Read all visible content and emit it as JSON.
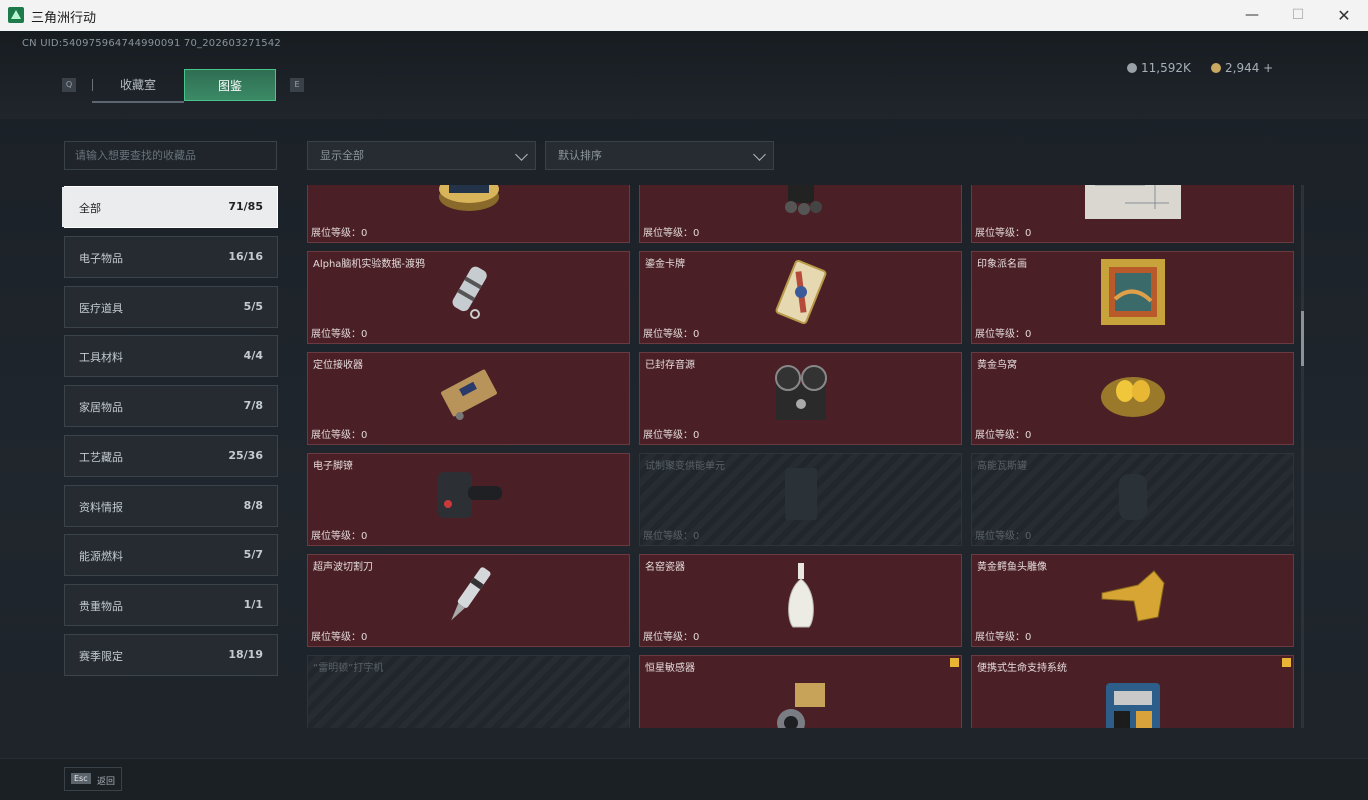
{
  "window": {
    "title": "三角洲行动",
    "minimize": "—",
    "maximize": "☐",
    "close": "✕"
  },
  "header": {
    "uid": "CN UID:540975964744990091 70_202603271542",
    "tab_key_left": "Q",
    "tab_key_right": "E",
    "tabs": [
      {
        "label": "收藏室"
      },
      {
        "label": "图鉴",
        "active": true
      }
    ],
    "currency": [
      {
        "value": "11,592K"
      },
      {
        "value": "2,944 +"
      }
    ]
  },
  "search": {
    "placeholder": "请输入想要查找的收藏品"
  },
  "filters": {
    "show": "显示全部",
    "sort": "默认排序"
  },
  "categories": [
    {
      "label": "全部",
      "count": "71/85",
      "active": true
    },
    {
      "label": "电子物品",
      "count": "16/16"
    },
    {
      "label": "医疗道具",
      "count": "5/5"
    },
    {
      "label": "工具材料",
      "count": "4/4"
    },
    {
      "label": "家居物品",
      "count": "7/8"
    },
    {
      "label": "工艺藏品",
      "count": "25/36"
    },
    {
      "label": "资料情报",
      "count": "8/8"
    },
    {
      "label": "能源燃料",
      "count": "5/7"
    },
    {
      "label": "贵重物品",
      "count": "1/1"
    },
    {
      "label": "赛季限定",
      "count": "18/19"
    }
  ],
  "level_label": "展位等级：",
  "items": [
    {
      "name": "",
      "level": "0",
      "icon": "caviar-tin-icon"
    },
    {
      "name": "",
      "level": "0",
      "icon": "machine-icon"
    },
    {
      "name": "",
      "level": "0",
      "icon": "blueprint-icon"
    },
    {
      "name": "Alpha脑机实验数据-渡鸦",
      "level": "0",
      "icon": "data-capsule-icon"
    },
    {
      "name": "鎏金卡牌",
      "level": "0",
      "icon": "gold-card-icon"
    },
    {
      "name": "印象派名画",
      "level": "0",
      "icon": "painting-icon"
    },
    {
      "name": "定位接收器",
      "level": "0",
      "icon": "receiver-icon"
    },
    {
      "name": "已封存音源",
      "level": "0",
      "icon": "reel-recorder-icon"
    },
    {
      "name": "黄金鸟窝",
      "level": "0",
      "icon": "golden-nest-icon"
    },
    {
      "name": "电子脚镣",
      "level": "0",
      "icon": "ankle-monitor-icon"
    },
    {
      "name": "试制聚变供能单元",
      "level": "0",
      "icon": "fusion-unit-icon",
      "locked": true
    },
    {
      "name": "高能瓦斯罐",
      "level": "0",
      "icon": "gas-canister-icon",
      "locked": true
    },
    {
      "name": "超声波切割刀",
      "level": "0",
      "icon": "ultrasonic-cutter-icon"
    },
    {
      "name": "名窑瓷器",
      "level": "0",
      "icon": "porcelain-vase-icon"
    },
    {
      "name": "黄金鳄鱼头雕像",
      "level": "0",
      "icon": "golden-croc-icon"
    },
    {
      "name": "“雷明顿”打字机",
      "level": "",
      "icon": "typewriter-icon",
      "locked": true
    },
    {
      "name": "恒星敏感器",
      "level": "",
      "icon": "star-sensor-icon",
      "star": true
    },
    {
      "name": "便携式生命支持系统",
      "level": "",
      "icon": "life-support-icon",
      "star": true
    }
  ],
  "footer": {
    "esc_key": "Esc",
    "back": "返回"
  },
  "colors": {
    "accent": "#3b8a66",
    "card": "#4a2026",
    "gold": "#e8b634"
  }
}
